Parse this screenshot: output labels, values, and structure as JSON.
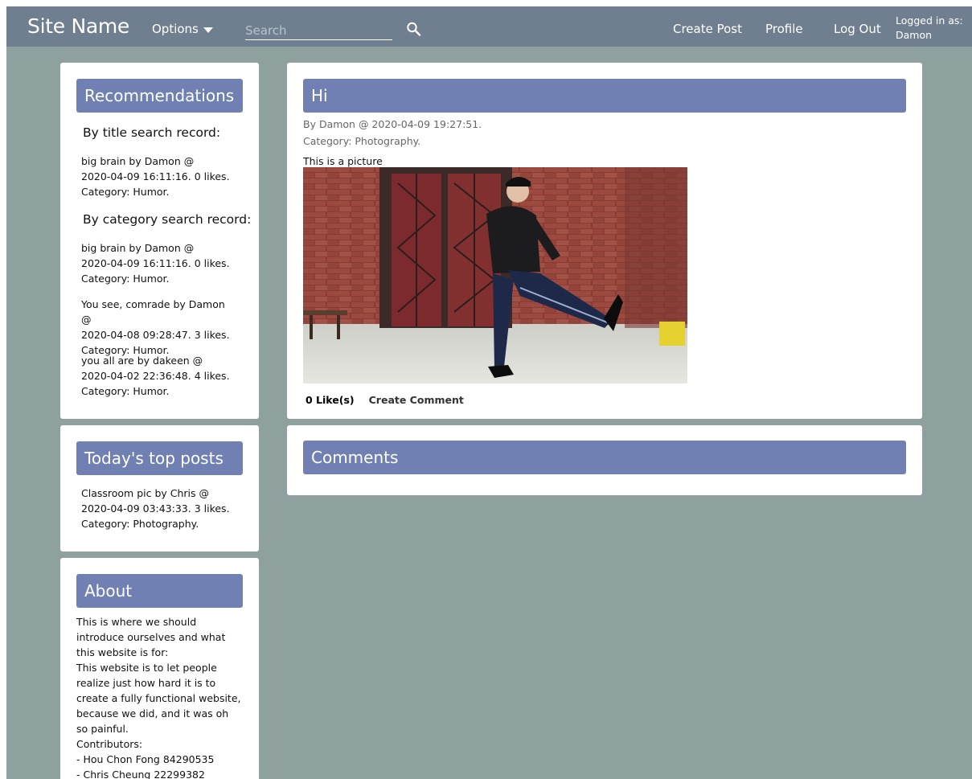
{
  "navbar": {
    "brand": "Site Name",
    "options_label": "Options",
    "search_placeholder": "Search",
    "links": [
      "Create Post",
      "Profile",
      "Log Out"
    ],
    "logged_in_label": "Logged in as:",
    "username": "Damon"
  },
  "recommendations": {
    "title": "Recommendations",
    "by_title_label": "By title search record:",
    "by_title": [
      {
        "line1": "big brain by Damon @",
        "line2": "2020-04-09 16:11:16. 0 likes.",
        "line3": "Category: Humor."
      }
    ],
    "by_category_label": "By category search record:",
    "by_category": [
      {
        "line1": "big brain by Damon @",
        "line2": "2020-04-09 16:11:16. 0 likes.",
        "line3": "Category: Humor."
      },
      {
        "line1": "You see, comrade by Damon @",
        "line2": "2020-04-08 09:28:47. 3 likes.",
        "line3": "Category: Humor."
      },
      {
        "line1": "you all are by dakeen @",
        "line2": "2020-04-02 22:36:48. 4 likes.",
        "line3": "Category: Humor."
      }
    ]
  },
  "top_posts": {
    "title": "Today's top posts",
    "items": [
      {
        "line1": "Classroom pic by Chris @",
        "line2": "2020-04-09 03:43:33. 3 likes.",
        "line3": "Category: Photography."
      }
    ]
  },
  "about": {
    "title": "About",
    "text": "This is where we should introduce ourselves and what this website is for:\nThis website is to let people realize just how hard it is to create a fully functional website, because we did, and it was oh so painful.\nContributors:\n- Hou Chon Fong 84290535\n- Chris Cheung 22299382"
  },
  "post": {
    "title": "Hi",
    "byline": "By Damon @ 2020-04-09 19:27:51.",
    "category": "Category: Photography.",
    "body": "This is a picture",
    "likes": "0 Like(s)",
    "create_comment": "Create Comment"
  },
  "comments": {
    "title": "Comments"
  },
  "colors": {
    "navbar": "#6f7f8f",
    "background": "#8fa19f",
    "header": "#7080b2"
  }
}
